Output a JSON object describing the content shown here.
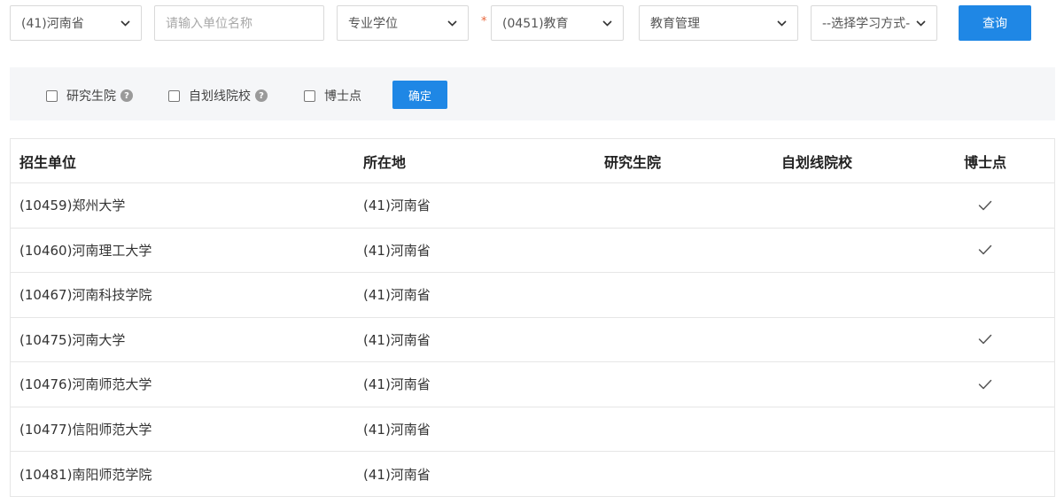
{
  "search": {
    "province": "(41)河南省",
    "unit_placeholder": "请输入单位名称",
    "degree_type": "专业学位",
    "required_mark": "*",
    "discipline": "(0451)教育",
    "major": "教育管理",
    "study_mode": "--选择学习方式--",
    "query_label": "查询"
  },
  "filters": {
    "graduate_school": "研究生院",
    "self_line": "自划线院校",
    "phd_point": "博士点",
    "help_glyph": "?",
    "confirm_label": "确定"
  },
  "table": {
    "headers": {
      "unit": "招生单位",
      "location": "所在地",
      "graduate_school": "研究生院",
      "self_line": "自划线院校",
      "phd_point": "博士点"
    },
    "rows": [
      {
        "unit": "(10459)郑州大学",
        "location": "(41)河南省",
        "graduate_school": false,
        "self_line": false,
        "phd_point": true
      },
      {
        "unit": "(10460)河南理工大学",
        "location": "(41)河南省",
        "graduate_school": false,
        "self_line": false,
        "phd_point": true
      },
      {
        "unit": "(10467)河南科技学院",
        "location": "(41)河南省",
        "graduate_school": false,
        "self_line": false,
        "phd_point": false
      },
      {
        "unit": "(10475)河南大学",
        "location": "(41)河南省",
        "graduate_school": false,
        "self_line": false,
        "phd_point": true
      },
      {
        "unit": "(10476)河南师范大学",
        "location": "(41)河南省",
        "graduate_school": false,
        "self_line": false,
        "phd_point": true
      },
      {
        "unit": "(10477)信阳师范大学",
        "location": "(41)河南省",
        "graduate_school": false,
        "self_line": false,
        "phd_point": false
      },
      {
        "unit": "(10481)南阳师范学院",
        "location": "(41)河南省",
        "graduate_school": false,
        "self_line": false,
        "phd_point": false
      }
    ]
  },
  "colors": {
    "primary": "#1f87e5",
    "required": "#e8663b",
    "filter_bg": "#f5f6f8",
    "border": "#e6e6e6"
  },
  "icons": {
    "dropdown": "chevron-down-icon",
    "help": "help-circle-icon",
    "check": "check-mark-icon"
  }
}
